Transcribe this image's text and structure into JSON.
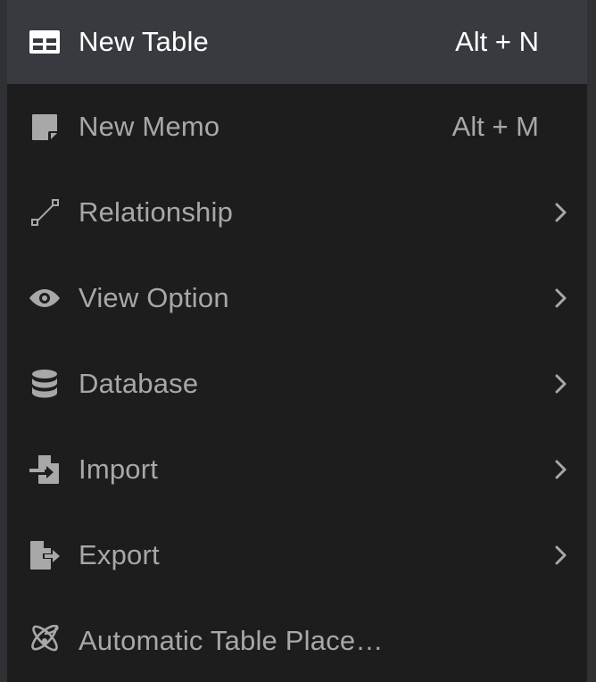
{
  "menu": {
    "items": [
      {
        "label": "New Table",
        "shortcut": "Alt + N",
        "icon": "table-icon",
        "active": true,
        "submenu": false
      },
      {
        "label": "New Memo",
        "shortcut": "Alt + M",
        "icon": "memo-icon",
        "active": false,
        "submenu": false
      },
      {
        "label": "Relationship",
        "icon": "relationship-icon",
        "active": false,
        "submenu": true
      },
      {
        "label": "View Option",
        "icon": "eye-icon",
        "active": false,
        "submenu": true
      },
      {
        "label": "Database",
        "icon": "database-icon",
        "active": false,
        "submenu": true
      },
      {
        "label": "Import",
        "icon": "import-icon",
        "active": false,
        "submenu": true
      },
      {
        "label": "Export",
        "icon": "export-icon",
        "active": false,
        "submenu": true
      },
      {
        "label": "Automatic Table Place…",
        "icon": "atom-icon",
        "active": false,
        "submenu": false
      }
    ]
  },
  "colors": {
    "menu_background": "#1d1d1d",
    "active_background": "#373b3f",
    "text": "#a8a8a8",
    "active_text": "#ffffff"
  }
}
